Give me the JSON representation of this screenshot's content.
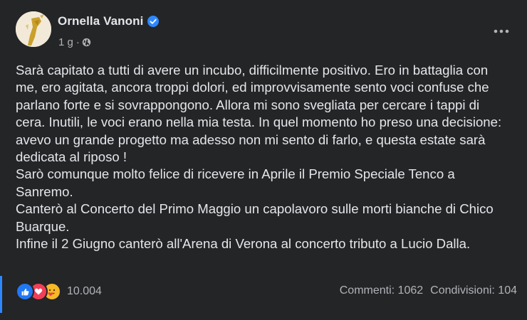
{
  "post": {
    "author": "Ornella Vanoni",
    "time": "1 g",
    "separator": "·",
    "text": "Sarà capitato a tutti di avere un incubo, difficilmente positivo. Ero in battaglia con\nme, ero agitata, ancora troppi dolori, ed improvvisamente sento voci confuse che\nparlano forte e si sovrappongono. Allora mi sono svegliata per cercare i tappi di\ncera. Inutili, le voci erano nella mia testa. In quel momento ho preso una decisione:\navevo un grande progetto ma adesso non mi sento di farlo, e questa estate sarà\ndedicata al riposo !\nSarò comunque molto felice di ricevere in Aprile il Premio Speciale Tenco a\nSanremo.\nCanterò al Concerto del Primo Maggio un capolavoro sulle morti bianche di Chico\nBuarque.\nInfine il 2 Giugno canterò all'Arena di Verona al concerto tributo a Lucio Dalla."
  },
  "footer": {
    "reaction_count": "10.004",
    "comments": "Commenti: 1062",
    "shares": "Condivisioni: 104"
  },
  "colors": {
    "background": "#242526",
    "text": "#e4e6eb",
    "secondary_text": "#b0b3b8",
    "accent": "#2d88ff",
    "like": "#2078f4",
    "love": "#f33e58",
    "care": "#f7b928"
  },
  "icons": [
    "verified-badge-icon",
    "globe-icon",
    "more-options-icon",
    "like-reaction-icon",
    "love-reaction-icon",
    "care-reaction-icon"
  ]
}
